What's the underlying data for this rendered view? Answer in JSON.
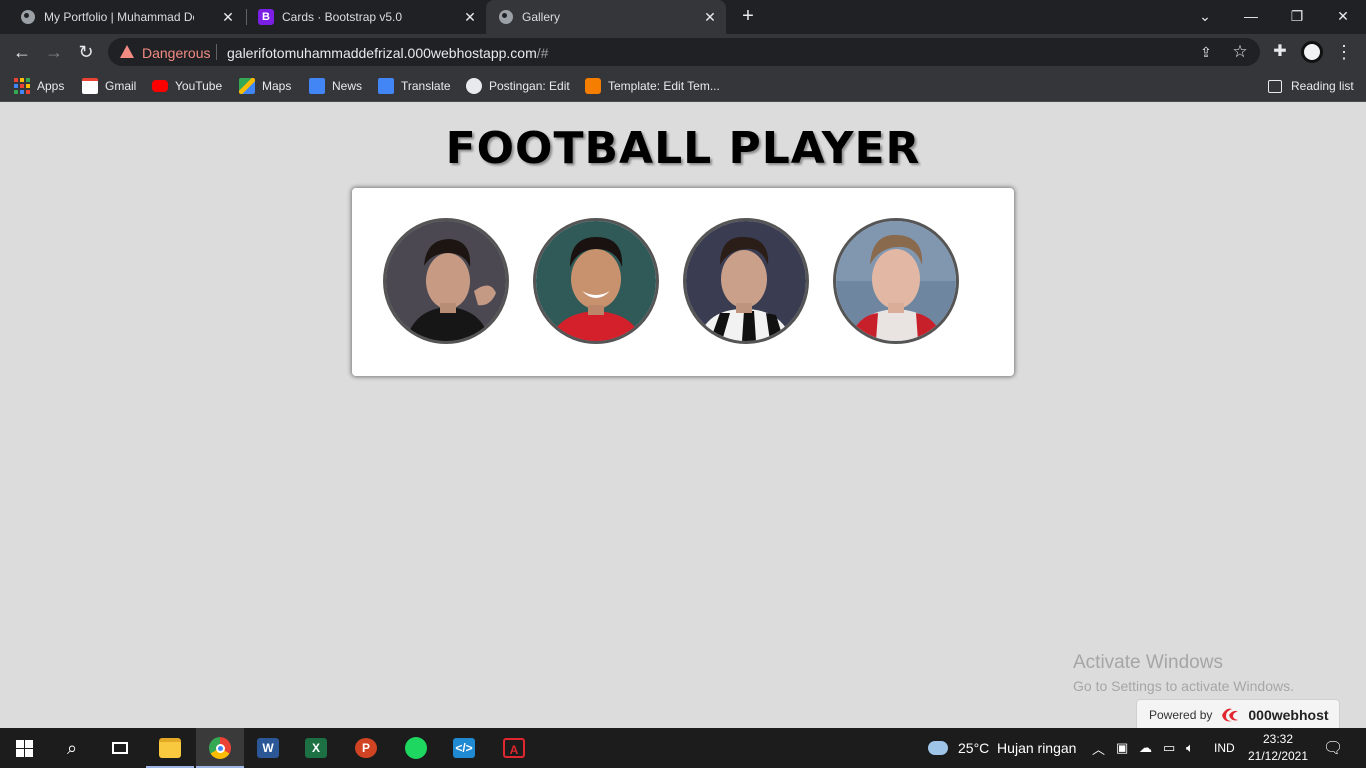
{
  "browser": {
    "tabs": [
      {
        "title": "My Portfolio | Muhammad Defriza",
        "icon": "globe-icon",
        "active": false
      },
      {
        "title": "Cards · Bootstrap v5.0",
        "icon": "bootstrap-icon",
        "active": false
      },
      {
        "title": "Gallery",
        "icon": "globe-icon",
        "active": true
      }
    ],
    "security_label": "Dangerous",
    "url_main": "galerifotomuhammaddefrizal.000webhostapp.com",
    "url_tail": "/#",
    "bookmarks": [
      {
        "label": "Apps",
        "icon": "apps-grid-icon"
      },
      {
        "label": "Gmail",
        "icon": "gmail-icon"
      },
      {
        "label": "YouTube",
        "icon": "youtube-icon"
      },
      {
        "label": "Maps",
        "icon": "maps-icon"
      },
      {
        "label": "News",
        "icon": "news-icon"
      },
      {
        "label": "Translate",
        "icon": "translate-icon"
      },
      {
        "label": "Postingan: Edit",
        "icon": "globe-icon"
      },
      {
        "label": "Template: Edit Tem...",
        "icon": "blogger-icon"
      }
    ],
    "reading_list": "Reading list"
  },
  "page": {
    "heading": "FOOTBALL PLAYER",
    "players": [
      {
        "name": "player-photo-1"
      },
      {
        "name": "player-photo-2"
      },
      {
        "name": "player-photo-3"
      },
      {
        "name": "player-photo-4"
      }
    ]
  },
  "overlay": {
    "activate_title": "Activate Windows",
    "activate_sub": "Go to Settings to activate Windows.",
    "powered_by": "Powered by",
    "powered_brand": "000webhost"
  },
  "taskbar": {
    "weather": "25°C  Hujan ringan",
    "language": "IND",
    "time": "23:32",
    "date": "21/12/2021"
  },
  "colors": {
    "page_bg": "#dcdcdc",
    "chrome_dark": "#202124",
    "toolbar": "#35363a",
    "danger": "#f28b82"
  }
}
